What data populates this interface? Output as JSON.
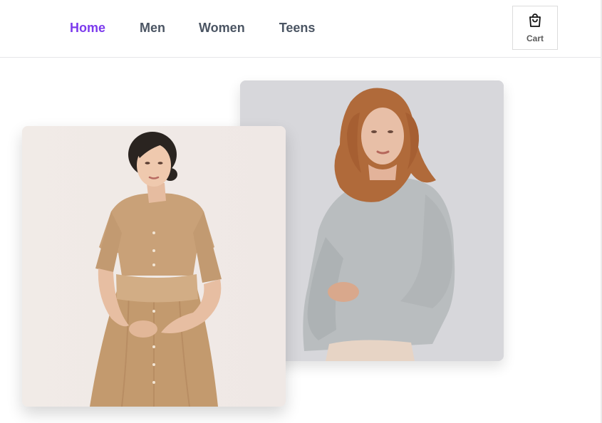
{
  "nav": {
    "links": [
      {
        "label": "Home",
        "active": true
      },
      {
        "label": "Men",
        "active": false
      },
      {
        "label": "Women",
        "active": false
      },
      {
        "label": "Teens",
        "active": false
      }
    ],
    "cart_label": "Cart",
    "cart_icon": "shopping-bag-icon"
  },
  "colors": {
    "accent": "#7c3aed",
    "nav_text": "#4b5563",
    "teen_card_bg": "#d8d8dc",
    "dress_card_bg": "#f2ede9"
  },
  "images": [
    {
      "name": "woman-grey-sweater-photo"
    },
    {
      "name": "woman-tan-dress-photo"
    }
  ]
}
